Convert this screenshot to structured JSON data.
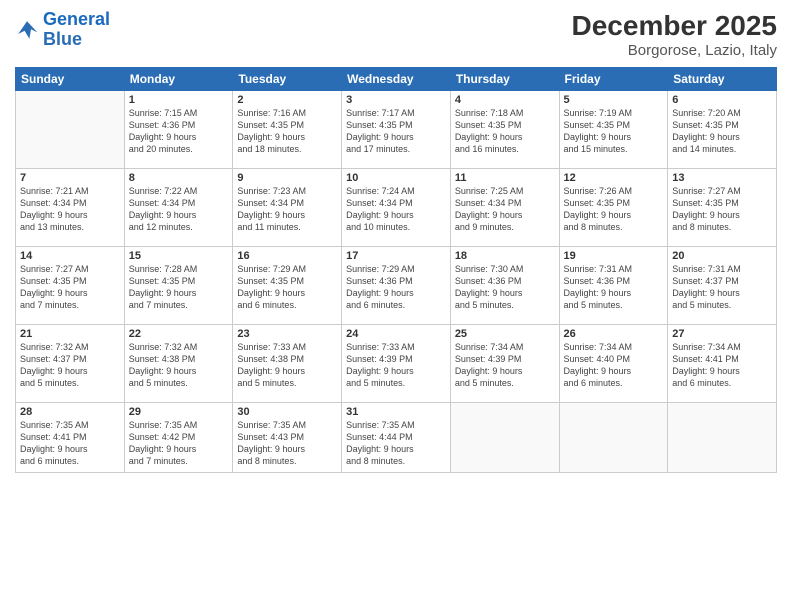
{
  "header": {
    "logo_line1": "General",
    "logo_line2": "Blue",
    "month": "December 2025",
    "location": "Borgorose, Lazio, Italy"
  },
  "weekdays": [
    "Sunday",
    "Monday",
    "Tuesday",
    "Wednesday",
    "Thursday",
    "Friday",
    "Saturday"
  ],
  "weeks": [
    [
      {
        "day": "",
        "content": ""
      },
      {
        "day": "1",
        "content": "Sunrise: 7:15 AM\nSunset: 4:36 PM\nDaylight: 9 hours\nand 20 minutes."
      },
      {
        "day": "2",
        "content": "Sunrise: 7:16 AM\nSunset: 4:35 PM\nDaylight: 9 hours\nand 18 minutes."
      },
      {
        "day": "3",
        "content": "Sunrise: 7:17 AM\nSunset: 4:35 PM\nDaylight: 9 hours\nand 17 minutes."
      },
      {
        "day": "4",
        "content": "Sunrise: 7:18 AM\nSunset: 4:35 PM\nDaylight: 9 hours\nand 16 minutes."
      },
      {
        "day": "5",
        "content": "Sunrise: 7:19 AM\nSunset: 4:35 PM\nDaylight: 9 hours\nand 15 minutes."
      },
      {
        "day": "6",
        "content": "Sunrise: 7:20 AM\nSunset: 4:35 PM\nDaylight: 9 hours\nand 14 minutes."
      }
    ],
    [
      {
        "day": "7",
        "content": "Sunrise: 7:21 AM\nSunset: 4:34 PM\nDaylight: 9 hours\nand 13 minutes."
      },
      {
        "day": "8",
        "content": "Sunrise: 7:22 AM\nSunset: 4:34 PM\nDaylight: 9 hours\nand 12 minutes."
      },
      {
        "day": "9",
        "content": "Sunrise: 7:23 AM\nSunset: 4:34 PM\nDaylight: 9 hours\nand 11 minutes."
      },
      {
        "day": "10",
        "content": "Sunrise: 7:24 AM\nSunset: 4:34 PM\nDaylight: 9 hours\nand 10 minutes."
      },
      {
        "day": "11",
        "content": "Sunrise: 7:25 AM\nSunset: 4:34 PM\nDaylight: 9 hours\nand 9 minutes."
      },
      {
        "day": "12",
        "content": "Sunrise: 7:26 AM\nSunset: 4:35 PM\nDaylight: 9 hours\nand 8 minutes."
      },
      {
        "day": "13",
        "content": "Sunrise: 7:27 AM\nSunset: 4:35 PM\nDaylight: 9 hours\nand 8 minutes."
      }
    ],
    [
      {
        "day": "14",
        "content": "Sunrise: 7:27 AM\nSunset: 4:35 PM\nDaylight: 9 hours\nand 7 minutes."
      },
      {
        "day": "15",
        "content": "Sunrise: 7:28 AM\nSunset: 4:35 PM\nDaylight: 9 hours\nand 7 minutes."
      },
      {
        "day": "16",
        "content": "Sunrise: 7:29 AM\nSunset: 4:35 PM\nDaylight: 9 hours\nand 6 minutes."
      },
      {
        "day": "17",
        "content": "Sunrise: 7:29 AM\nSunset: 4:36 PM\nDaylight: 9 hours\nand 6 minutes."
      },
      {
        "day": "18",
        "content": "Sunrise: 7:30 AM\nSunset: 4:36 PM\nDaylight: 9 hours\nand 5 minutes."
      },
      {
        "day": "19",
        "content": "Sunrise: 7:31 AM\nSunset: 4:36 PM\nDaylight: 9 hours\nand 5 minutes."
      },
      {
        "day": "20",
        "content": "Sunrise: 7:31 AM\nSunset: 4:37 PM\nDaylight: 9 hours\nand 5 minutes."
      }
    ],
    [
      {
        "day": "21",
        "content": "Sunrise: 7:32 AM\nSunset: 4:37 PM\nDaylight: 9 hours\nand 5 minutes."
      },
      {
        "day": "22",
        "content": "Sunrise: 7:32 AM\nSunset: 4:38 PM\nDaylight: 9 hours\nand 5 minutes."
      },
      {
        "day": "23",
        "content": "Sunrise: 7:33 AM\nSunset: 4:38 PM\nDaylight: 9 hours\nand 5 minutes."
      },
      {
        "day": "24",
        "content": "Sunrise: 7:33 AM\nSunset: 4:39 PM\nDaylight: 9 hours\nand 5 minutes."
      },
      {
        "day": "25",
        "content": "Sunrise: 7:34 AM\nSunset: 4:39 PM\nDaylight: 9 hours\nand 5 minutes."
      },
      {
        "day": "26",
        "content": "Sunrise: 7:34 AM\nSunset: 4:40 PM\nDaylight: 9 hours\nand 6 minutes."
      },
      {
        "day": "27",
        "content": "Sunrise: 7:34 AM\nSunset: 4:41 PM\nDaylight: 9 hours\nand 6 minutes."
      }
    ],
    [
      {
        "day": "28",
        "content": "Sunrise: 7:35 AM\nSunset: 4:41 PM\nDaylight: 9 hours\nand 6 minutes."
      },
      {
        "day": "29",
        "content": "Sunrise: 7:35 AM\nSunset: 4:42 PM\nDaylight: 9 hours\nand 7 minutes."
      },
      {
        "day": "30",
        "content": "Sunrise: 7:35 AM\nSunset: 4:43 PM\nDaylight: 9 hours\nand 8 minutes."
      },
      {
        "day": "31",
        "content": "Sunrise: 7:35 AM\nSunset: 4:44 PM\nDaylight: 9 hours\nand 8 minutes."
      },
      {
        "day": "",
        "content": ""
      },
      {
        "day": "",
        "content": ""
      },
      {
        "day": "",
        "content": ""
      }
    ]
  ]
}
